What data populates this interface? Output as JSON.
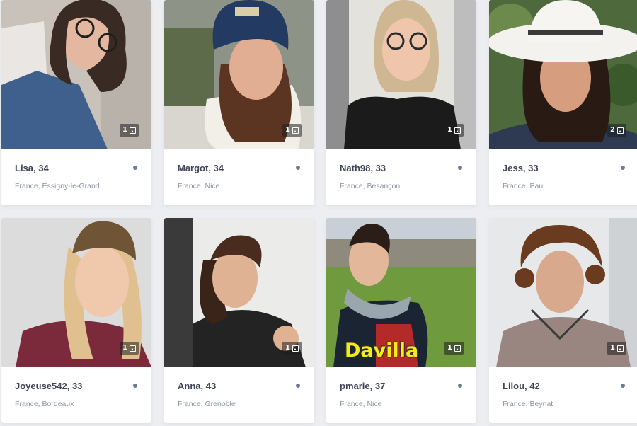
{
  "colors": {
    "page_background": "#eceef2",
    "card_background": "#ffffff",
    "name_text": "#3f4556",
    "location_text": "#8c93a2",
    "status_dot": "#6c7a93",
    "overlay_caption": "#f3ec1c"
  },
  "icons": {
    "photo_count": "image-icon",
    "status": "online-status-dot"
  },
  "profiles": [
    {
      "name_age": "Lisa, 34",
      "location": "France, Essigny-le-Grand",
      "photo_count": "1"
    },
    {
      "name_age": "Margot, 34",
      "location": "France, Nice",
      "photo_count": "1"
    },
    {
      "name_age": "Nath98, 33",
      "location": "France, Besançon",
      "photo_count": "1"
    },
    {
      "name_age": "Jess, 33",
      "location": "France, Pau",
      "photo_count": "2"
    },
    {
      "name_age": "Joyeuse542, 33",
      "location": "France, Bordeaux",
      "photo_count": "1"
    },
    {
      "name_age": "Anna, 43",
      "location": "France, Grenoble",
      "photo_count": "1"
    },
    {
      "name_age": "pmarie, 37",
      "location": "France, Nice",
      "photo_count": "1",
      "photo_caption": "Davilla"
    },
    {
      "name_age": "Lilou, 42",
      "location": "France, Beynat",
      "photo_count": "1"
    }
  ]
}
